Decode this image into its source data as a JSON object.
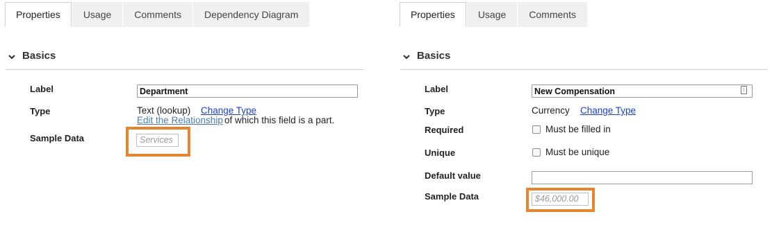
{
  "left": {
    "tabs": [
      {
        "label": "Properties",
        "active": true
      },
      {
        "label": "Usage"
      },
      {
        "label": "Comments"
      },
      {
        "label": "Dependency Diagram"
      }
    ],
    "section_title": "Basics",
    "label_field": {
      "label": "Label",
      "value": "Department"
    },
    "type_field": {
      "label": "Type",
      "value": "Text (lookup)",
      "change_link": "Change Type",
      "edit_link": "Edit the Relationship",
      "edit_suffix": "of which this field is a part."
    },
    "sample_field": {
      "label": "Sample Data",
      "placeholder": "Services"
    }
  },
  "right": {
    "tabs": [
      {
        "label": "Properties",
        "active": true
      },
      {
        "label": "Usage"
      },
      {
        "label": "Comments"
      }
    ],
    "section_title": "Basics",
    "label_field": {
      "label": "Label",
      "value": "New Compensation"
    },
    "type_field": {
      "label": "Type",
      "value": "Currency",
      "change_link": "Change Type"
    },
    "required_field": {
      "label": "Required",
      "checkbox_label": "Must be filled in"
    },
    "unique_field": {
      "label": "Unique",
      "checkbox_label": "Must be unique"
    },
    "default_field": {
      "label": "Default value",
      "value": ""
    },
    "sample_field": {
      "label": "Sample Data",
      "placeholder": "$46,000.00"
    }
  },
  "icons": {
    "chevron": "chevron-down-icon",
    "field_picker": "field-picker-icon"
  },
  "colors": {
    "highlight": "#e8832f",
    "link": "#1a3fc7"
  }
}
